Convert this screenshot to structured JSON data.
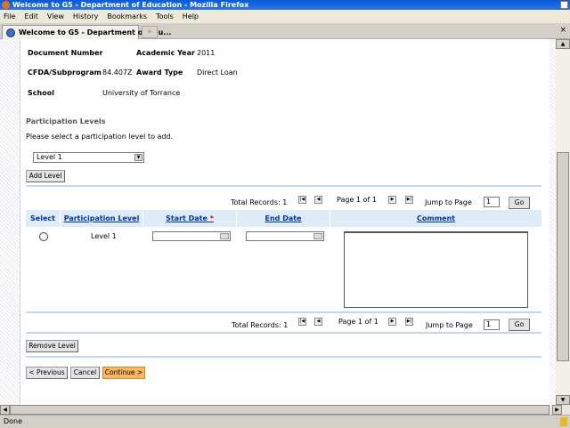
{
  "window": {
    "title": "Welcome to G5 - Department of Education - Mozilla Firefox"
  },
  "menu": [
    "File",
    "Edit",
    "View",
    "History",
    "Bookmarks",
    "Tools",
    "Help"
  ],
  "tab": {
    "label": "Welcome to G5 - Department of Edu...",
    "new_tab": "+"
  },
  "info": {
    "document_number_label": "Document Number",
    "document_number": "",
    "academic_year_label": "Academic Year",
    "academic_year": "2011",
    "cfda_label": "CFDA/Subprogram",
    "cfda": "84.407Z",
    "award_type_label": "Award Type",
    "award_type": "Direct Loan",
    "school_label": "School",
    "school": "University of Torrance"
  },
  "participation": {
    "heading": "Participation Levels",
    "instruction": "Please select a participation level to add.",
    "selected_level": "Level 1",
    "add_button": "Add Level",
    "remove_button": "Remove Level"
  },
  "pager": {
    "total": "Total Records: 1",
    "page": "Page 1 of 1",
    "jump_label": "Jump to Page",
    "jump_value": "1",
    "go": "Go"
  },
  "table": {
    "headers": {
      "select": "Select",
      "level": "Participation Level",
      "start": "Start Date",
      "required": "*",
      "end": "End Date",
      "comment": "Comment"
    },
    "rows": [
      {
        "level": "Level 1",
        "start": "",
        "end": "",
        "comment": ""
      }
    ]
  },
  "nav": {
    "previous": "< Previous",
    "cancel": "Cancel",
    "continue": "Continue >"
  },
  "status": {
    "text": "Done"
  }
}
